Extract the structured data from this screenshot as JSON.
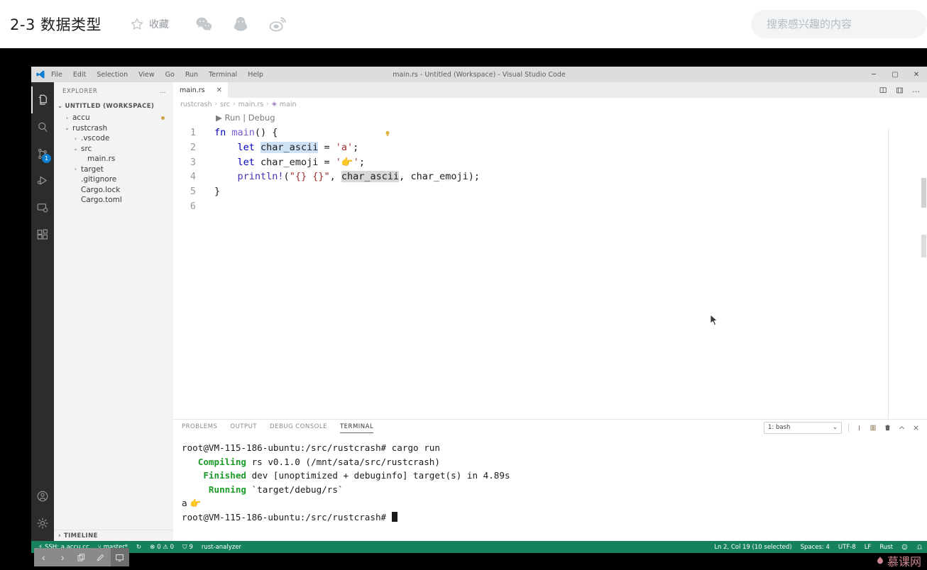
{
  "page_header": {
    "title": "2-3 数据类型",
    "favorite_label": "收藏",
    "social": [
      {
        "name": "wechat-icon"
      },
      {
        "name": "qq-icon"
      },
      {
        "name": "weibo-icon"
      }
    ],
    "search": {
      "placeholder": "搜索感兴趣的内容",
      "value": ""
    }
  },
  "vscode": {
    "window_title": "main.rs - Untitled (Workspace) - Visual Studio Code",
    "menu": [
      "File",
      "Edit",
      "Selection",
      "View",
      "Go",
      "Run",
      "Terminal",
      "Help"
    ],
    "window_controls": {
      "minimize": "─",
      "maximize": "▢",
      "close": "✕"
    },
    "activity_bar": [
      {
        "name": "explorer-icon",
        "label": "Explorer",
        "active": true,
        "badge": ""
      },
      {
        "name": "search-icon",
        "label": "Search",
        "active": false,
        "badge": ""
      },
      {
        "name": "source-control-icon",
        "label": "Source Control",
        "active": false,
        "badge": "1"
      },
      {
        "name": "run-debug-icon",
        "label": "Run and Debug",
        "active": false,
        "badge": ""
      },
      {
        "name": "remote-explorer-icon",
        "label": "Remote Explorer",
        "active": false,
        "badge": ""
      },
      {
        "name": "extensions-icon",
        "label": "Extensions",
        "active": false,
        "badge": ""
      }
    ],
    "activity_bar_bottom": [
      {
        "name": "accounts-icon",
        "label": "Accounts"
      },
      {
        "name": "settings-gear-icon",
        "label": "Manage"
      }
    ],
    "sidebar": {
      "header": "EXPLORER",
      "more_label": "…",
      "root_section": "UNTITLED (WORKSPACE)",
      "timeline_section": "TIMELINE",
      "tree": [
        {
          "label": "accu",
          "indent": 1,
          "chevron": "›",
          "modified": true
        },
        {
          "label": "rustcrash",
          "indent": 1,
          "chevron": "⌄",
          "modified": false
        },
        {
          "label": ".vscode",
          "indent": 2,
          "chevron": "›",
          "modified": false
        },
        {
          "label": "src",
          "indent": 2,
          "chevron": "⌄",
          "modified": false
        },
        {
          "label": "main.rs",
          "indent": 3,
          "chevron": "",
          "modified": false
        },
        {
          "label": "target",
          "indent": 2,
          "chevron": "›",
          "modified": false
        },
        {
          "label": ".gitignore",
          "indent": 2,
          "chevron": "",
          "modified": false
        },
        {
          "label": "Cargo.lock",
          "indent": 2,
          "chevron": "",
          "modified": false
        },
        {
          "label": "Cargo.toml",
          "indent": 2,
          "chevron": "",
          "modified": false
        }
      ]
    },
    "editor": {
      "tab": {
        "label": "main.rs",
        "close": "✕"
      },
      "actions": [
        {
          "name": "split-editor-icon"
        },
        {
          "name": "editor-layout-icon"
        },
        {
          "name": "more-actions-icon",
          "glyph": "…"
        }
      ],
      "breadcrumb": [
        "rustcrash",
        "src",
        "main.rs",
        "main"
      ],
      "breadcrumb_separator": "›",
      "codelens": {
        "play": "▶",
        "run": "Run",
        "divider": "|",
        "debug": "Debug"
      },
      "lines": [
        {
          "no": "1",
          "text": "fn main() {"
        },
        {
          "no": "2",
          "text": "    let char_ascii = 'a';"
        },
        {
          "no": "3",
          "text": "    let char_emoji = '👉';"
        },
        {
          "no": "4",
          "text": "    println!(\"{} {}\", char_ascii, char_emoji);"
        },
        {
          "no": "5",
          "text": "}"
        },
        {
          "no": "6",
          "text": ""
        }
      ],
      "tokens": {
        "fn": "fn",
        "main": "main",
        "parens_brace": "() {",
        "let": "let",
        "char_ascii": "char_ascii",
        "char_emoji": "char_emoji",
        "eq": "=",
        "ascii_value": "'a'",
        "emoji_quote_open": "'",
        "emoji_char": "👉",
        "emoji_quote_close": "'",
        "semicolon": ";",
        "println": "println!",
        "format_string": "\"{} {}\"",
        "comma": ",",
        "close_brace": "}"
      }
    },
    "panel": {
      "tabs": [
        {
          "label": "PROBLEMS",
          "active": false
        },
        {
          "label": "OUTPUT",
          "active": false
        },
        {
          "label": "DEBUG CONSOLE",
          "active": false
        },
        {
          "label": "TERMINAL",
          "active": true
        }
      ],
      "terminal_select": {
        "value": "1: bash",
        "chevron": "⌄"
      },
      "actions": [
        {
          "name": "new-terminal-icon"
        },
        {
          "name": "split-terminal-icon"
        },
        {
          "name": "kill-terminal-icon"
        },
        {
          "name": "maximize-panel-icon"
        },
        {
          "name": "close-panel-icon"
        }
      ],
      "terminal_lines": [
        {
          "prompt": "root@VM-115-186-ubuntu:/src/rustcrash# ",
          "keyword": "",
          "rest": "cargo run"
        },
        {
          "prompt": "   ",
          "keyword": "Compiling",
          "rest": " rs v0.1.0 (/mnt/sata/src/rustcrash)"
        },
        {
          "prompt": "    ",
          "keyword": "Finished",
          "rest": " dev [unoptimized + debuginfo] target(s) in 4.89s"
        },
        {
          "prompt": "     ",
          "keyword": "Running",
          "rest": " `target/debug/rs`"
        },
        {
          "prompt": "",
          "keyword": "",
          "rest": "a 👉"
        },
        {
          "prompt": "root@VM-115-186-ubuntu:/src/rustcrash# ",
          "keyword": "",
          "rest": ""
        }
      ]
    },
    "status_bar": {
      "left": [
        {
          "name": "remote-ssh-indicator",
          "icon": "⚡",
          "label": "SSH: a.accu.cc"
        },
        {
          "name": "git-branch-indicator",
          "icon": "⑂",
          "label": "master*"
        },
        {
          "name": "sync-changes-indicator",
          "icon": "↻",
          "label": ""
        },
        {
          "name": "errors-warnings-indicator",
          "icon": "⊗",
          "label": "0  ⚠ 0"
        },
        {
          "name": "ports-indicator",
          "icon": "⛉",
          "label": "9"
        },
        {
          "name": "rust-analyzer-indicator",
          "icon": "",
          "label": "rust-analyzer"
        }
      ],
      "right": [
        {
          "name": "cursor-position-indicator",
          "label": "Ln 2, Col 19 (10 selected)"
        },
        {
          "name": "indentation-indicator",
          "label": "Spaces: 4"
        },
        {
          "name": "encoding-indicator",
          "label": "UTF-8"
        },
        {
          "name": "eol-indicator",
          "label": "LF"
        },
        {
          "name": "language-mode-indicator",
          "label": "Rust"
        },
        {
          "name": "feedback-smiley-icon",
          "label": ""
        },
        {
          "name": "notifications-bell-icon",
          "label": ""
        }
      ]
    }
  },
  "float_toolbar": [
    {
      "name": "back-icon",
      "glyph": "‹"
    },
    {
      "name": "forward-icon",
      "glyph": "›"
    },
    {
      "name": "copy-icon",
      "glyph": ""
    },
    {
      "name": "pencil-icon",
      "glyph": ""
    },
    {
      "name": "screen-share-icon",
      "glyph": ""
    }
  ],
  "watermark": {
    "label": "慕课网"
  },
  "colors": {
    "accent": "#0e7ed2",
    "status_bar": "#16825d",
    "terminal_green": "#1c9c28",
    "sidebar_bg": "#f3f3f3",
    "activity_bar_bg": "#2c2c2c",
    "watermark": "#f09ba6"
  }
}
